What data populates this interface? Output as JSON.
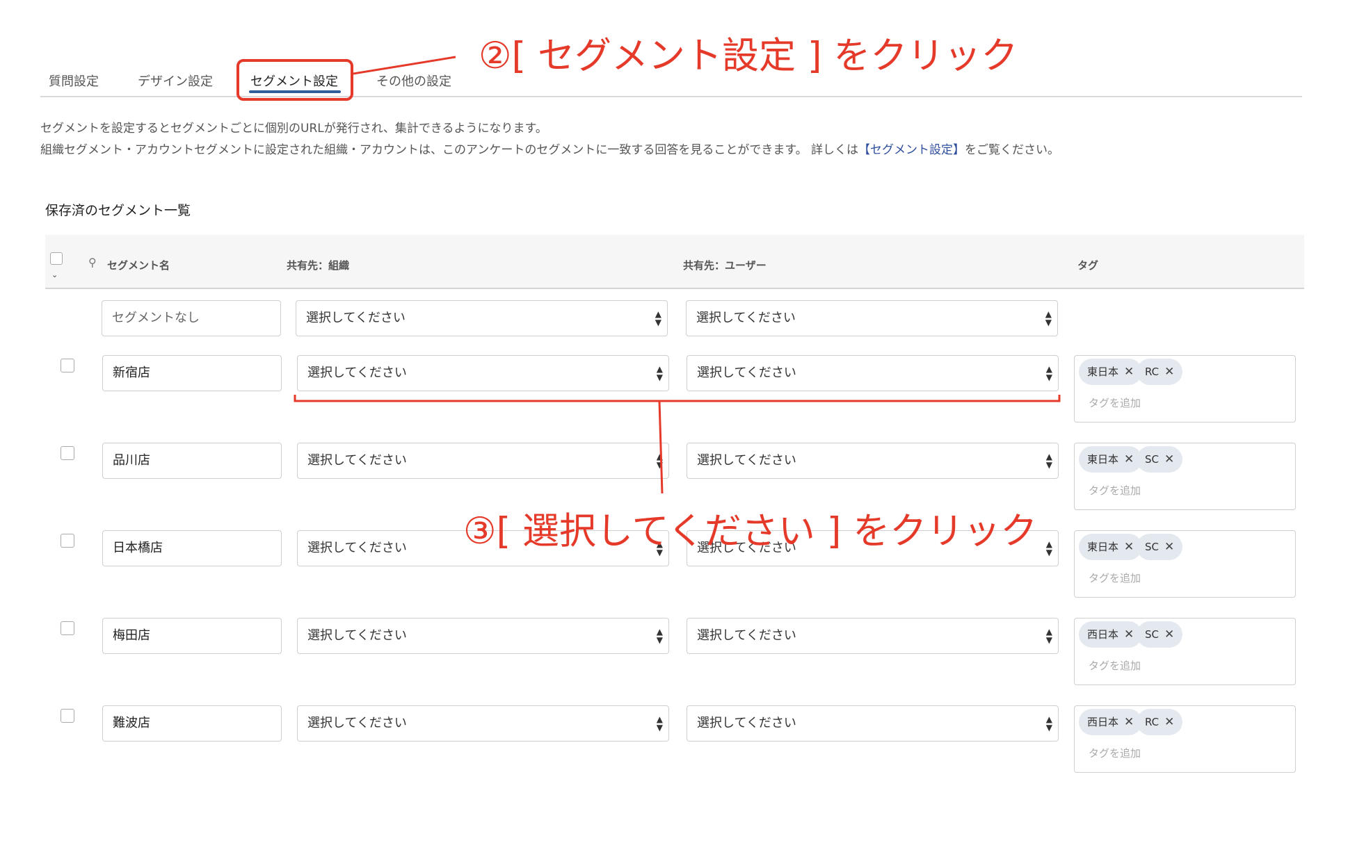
{
  "tabs": [
    {
      "label": "質問設定",
      "active": false
    },
    {
      "label": "デザイン設定",
      "active": false
    },
    {
      "label": "セグメント設定",
      "active": true
    },
    {
      "label": "その他の設定",
      "active": false
    }
  ],
  "description": {
    "line1": "セグメントを設定するとセグメントごとに個別のURLが発行され、集計できるようになります。",
    "line2_prefix": "組織セグメント・アカウントセグメントに設定された組織・アカウントは、このアンケートのセグメントに一致する回答を見ることができます。 詳しくは",
    "line2_link": "【セグメント設定】",
    "line2_suffix": "をご覧ください。"
  },
  "section_title": "保存済のセグメント一覧",
  "table": {
    "headers": {
      "name": "セグメント名",
      "share_org": "共有先：組織",
      "share_user": "共有先：ユーザー",
      "tags": "タグ"
    },
    "default_row": {
      "name": "セグメントなし",
      "org_select": "選択してください",
      "user_select": "選択してください"
    },
    "rows": [
      {
        "name": "新宿店",
        "org_select": "選択してください",
        "user_select": "選択してください",
        "tags": [
          "東日本",
          "RC"
        ],
        "tag_placeholder": "タグを追加"
      },
      {
        "name": "品川店",
        "org_select": "選択してください",
        "user_select": "選択してください",
        "tags": [
          "東日本",
          "SC"
        ],
        "tag_placeholder": "タグを追加"
      },
      {
        "name": "日本橋店",
        "org_select": "選択してください",
        "user_select": "選択してください",
        "tags": [
          "東日本",
          "SC"
        ],
        "tag_placeholder": "タグを追加"
      },
      {
        "name": "梅田店",
        "org_select": "選択してください",
        "user_select": "選択してください",
        "tags": [
          "西日本",
          "SC"
        ],
        "tag_placeholder": "タグを追加"
      },
      {
        "name": "難波店",
        "org_select": "選択してください",
        "user_select": "選択してください",
        "tags": [
          "西日本",
          "RC"
        ],
        "tag_placeholder": "タグを追加"
      }
    ]
  },
  "annotations": {
    "step2": "②[ セグメント設定 ] をクリック",
    "step3": "③[ 選択してください ] をクリック",
    "color": "#e53a2a"
  },
  "icons": {
    "search": "search-icon",
    "chevron": "chevron-down-icon",
    "select_arrows": "select-arrows-icon",
    "remove": "close-icon"
  }
}
